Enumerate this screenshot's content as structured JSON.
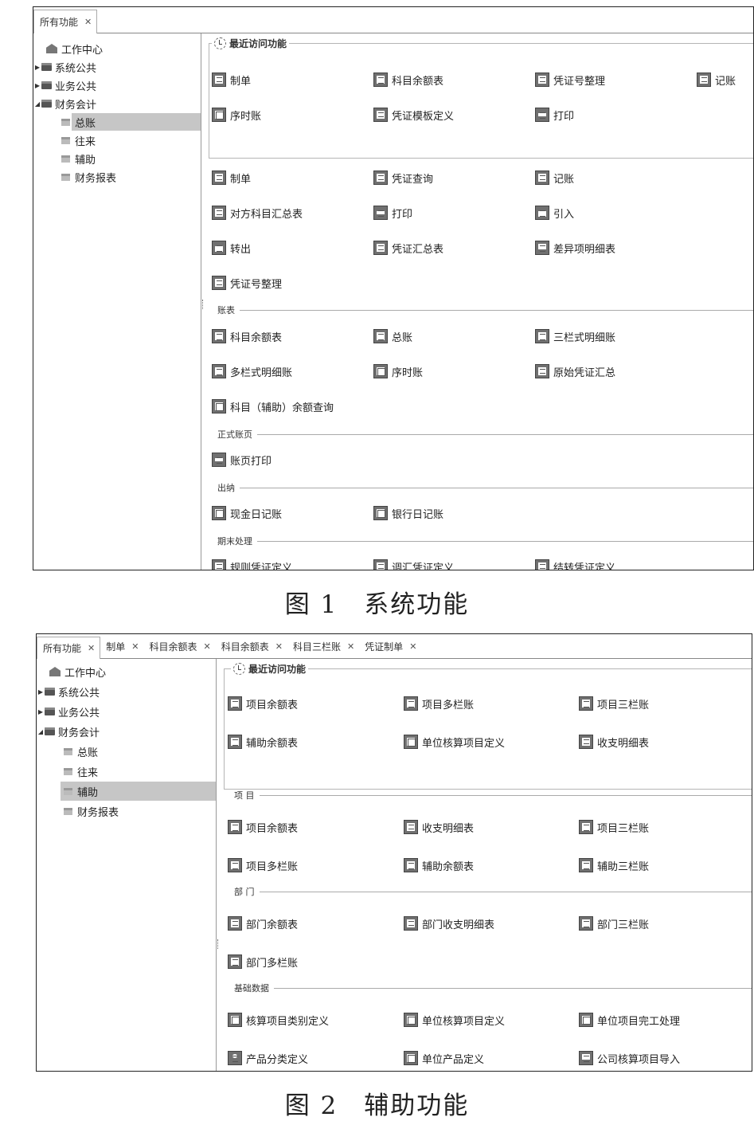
{
  "fig1": {
    "tabs": [
      {
        "label": "所有功能"
      }
    ],
    "tree": [
      {
        "label": "工作中心"
      },
      {
        "label": "系统公共"
      },
      {
        "label": "业务公共"
      },
      {
        "label": "财务会计"
      },
      {
        "label": "总账"
      },
      {
        "label": "往来"
      },
      {
        "label": "辅助"
      },
      {
        "label": "财务报表"
      }
    ],
    "recent_title": "最近访问功能",
    "recent": [
      {
        "label": "制单",
        "icon": "doc-icon"
      },
      {
        "label": "科目余额表",
        "icon": "ledger-icon"
      },
      {
        "label": "凭证号整理",
        "icon": "voucher-sort-icon"
      },
      {
        "label": "记账",
        "icon": "post-icon"
      },
      {
        "label": "序时账",
        "icon": "grid-icon"
      },
      {
        "label": "凭证模板定义",
        "icon": "template-icon"
      },
      {
        "label": "打印",
        "icon": "printer-icon"
      }
    ],
    "voucher_items": [
      {
        "label": "制单",
        "icon": "doc-icon"
      },
      {
        "label": "凭证查询",
        "icon": "voucher-search-icon"
      },
      {
        "label": "记账",
        "icon": "post-icon"
      },
      {
        "label": "对方科目汇总表",
        "icon": "summary-icon"
      },
      {
        "label": "打印",
        "icon": "printer-icon"
      },
      {
        "label": "引入",
        "icon": "import-icon"
      },
      {
        "label": "转出",
        "icon": "export-icon"
      },
      {
        "label": "凭证汇总表",
        "icon": "voucher-summary-icon"
      },
      {
        "label": "差异项明细表",
        "icon": "screen-icon"
      },
      {
        "label": "凭证号整理",
        "icon": "voucher-sort-icon"
      }
    ],
    "groups": {
      "ledger": "账表",
      "formal": "正式账页",
      "cashier": "出纳",
      "period_end": "期末处理"
    },
    "ledger_items": [
      {
        "label": "科目余额表",
        "icon": "ledger-icon"
      },
      {
        "label": "总账",
        "icon": "general-ledger-icon"
      },
      {
        "label": "三栏式明细账",
        "icon": "list-icon"
      },
      {
        "label": "多栏式明细账",
        "icon": "list-icon"
      },
      {
        "label": "序时账",
        "icon": "grid-icon"
      },
      {
        "label": "原始凭证汇总",
        "icon": "voucher-summary-icon"
      },
      {
        "label": "科目（辅助）余额查询",
        "icon": "balance-query-icon"
      }
    ],
    "formal_items": [
      {
        "label": "账页打印",
        "icon": "printer-icon"
      }
    ],
    "cashier_items": [
      {
        "label": "现金日记账",
        "icon": "cash-journal-icon"
      },
      {
        "label": "银行日记账",
        "icon": "bank-journal-icon"
      }
    ],
    "period_items": [
      {
        "label": "规则凭证定义",
        "icon": "rule-icon"
      },
      {
        "label": "调汇凭证定义",
        "icon": "exchange-icon"
      },
      {
        "label": "结转凭证定义",
        "icon": "carry-forward-icon"
      }
    ]
  },
  "fig2": {
    "tabs": [
      {
        "label": "所有功能"
      },
      {
        "label": "制单"
      },
      {
        "label": "科目余额表"
      },
      {
        "label": "科目余额表"
      },
      {
        "label": "科目三栏账"
      },
      {
        "label": "凭证制单"
      }
    ],
    "tree": [
      {
        "label": "工作中心"
      },
      {
        "label": "系统公共"
      },
      {
        "label": "业务公共"
      },
      {
        "label": "财务会计"
      },
      {
        "label": "总账"
      },
      {
        "label": "往来"
      },
      {
        "label": "辅助"
      },
      {
        "label": "财务报表"
      }
    ],
    "recent_title": "最近访问功能",
    "recent": [
      {
        "label": "项目余额表",
        "icon": "ledger-icon"
      },
      {
        "label": "项目多栏账",
        "icon": "list-icon"
      },
      {
        "label": "项目三栏账",
        "icon": "list-icon"
      },
      {
        "label": "辅助余额表",
        "icon": "aux-balance-icon"
      },
      {
        "label": "单位核算项目定义",
        "icon": "unit-item-icon"
      },
      {
        "label": "收支明细表",
        "icon": "income-detail-icon"
      }
    ],
    "groups": {
      "project": "项 目",
      "dept": "部 门",
      "base": "基础数据"
    },
    "project_items": [
      {
        "label": "项目余额表",
        "icon": "ledger-icon"
      },
      {
        "label": "收支明细表",
        "icon": "income-detail-icon"
      },
      {
        "label": "项目三栏账",
        "icon": "list-icon"
      },
      {
        "label": "项目多栏账",
        "icon": "list-icon"
      },
      {
        "label": "辅助余额表",
        "icon": "aux-balance-icon"
      },
      {
        "label": "辅助三栏账",
        "icon": "list-icon"
      }
    ],
    "dept_items": [
      {
        "label": "部门余额表",
        "icon": "dept-balance-icon"
      },
      {
        "label": "部门收支明细表",
        "icon": "dept-income-icon"
      },
      {
        "label": "部门三栏账",
        "icon": "list-icon"
      },
      {
        "label": "部门多栏账",
        "icon": "list-icon"
      }
    ],
    "base_items": [
      {
        "label": "核算项目类别定义",
        "icon": "category-icon"
      },
      {
        "label": "单位核算项目定义",
        "icon": "unit-item-icon"
      },
      {
        "label": "单位项目完工处理",
        "icon": "completion-icon"
      },
      {
        "label": "产品分类定义",
        "icon": "product-category-icon"
      },
      {
        "label": "单位产品定义",
        "icon": "unit-product-icon"
      },
      {
        "label": "公司核算项目导入",
        "icon": "screen-icon"
      }
    ]
  },
  "captions": {
    "fig1": "图 1　系统功能",
    "fig2": "图 2　辅助功能"
  }
}
